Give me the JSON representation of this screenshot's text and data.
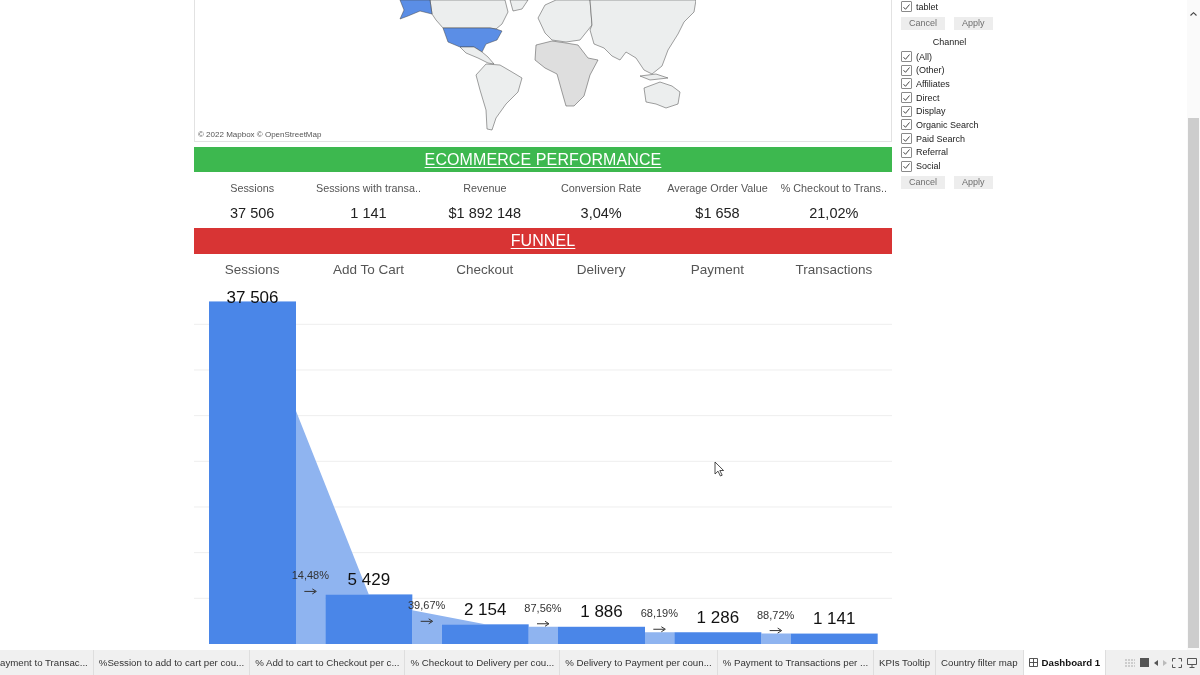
{
  "map": {
    "attribution": "© 2022 Mapbox © OpenStreetMap"
  },
  "ecommerce_performance": {
    "title": "ECOMMERCE PERFORMANCE",
    "kpis": [
      {
        "label": "Sessions",
        "value": "37 506"
      },
      {
        "label": "Sessions with transa..",
        "value": "1 141"
      },
      {
        "label": "Revenue",
        "value": "$1 892 148"
      },
      {
        "label": "Conversion Rate",
        "value": "3,04%"
      },
      {
        "label": "Average Order Value",
        "value": "$1 658"
      },
      {
        "label": "% Checkout to Trans..",
        "value": "21,02%"
      }
    ]
  },
  "funnel": {
    "title": "FUNNEL",
    "chart_data": [
      {
        "type": "bar",
        "categories": [
          "Sessions",
          "Add To Cart",
          "Checkout",
          "Delivery",
          "Payment",
          "Transactions"
        ],
        "values": [
          37506,
          5429,
          2154,
          1886,
          1286,
          1141
        ],
        "value_labels": [
          "37 506",
          "5 429",
          "2 154",
          "1 886",
          "1 286",
          "1 141"
        ],
        "data_labels": true,
        "color": "#4a86e8",
        "grid": true,
        "annotations": [
          "14,48%",
          "39,67%",
          "87,56%",
          "68,19%",
          "88,72%"
        ]
      }
    ]
  },
  "filters": [
    {
      "items": [
        {
          "label": "tablet",
          "checked": true
        }
      ],
      "buttons": [
        {
          "label": "Cancel",
          "disabled": true
        },
        {
          "label": "Apply",
          "disabled": true
        }
      ]
    },
    {
      "title": "Channel",
      "items": [
        {
          "label": "(All)",
          "checked": true
        },
        {
          "label": "(Other)",
          "checked": true
        },
        {
          "label": "Affiliates",
          "checked": true
        },
        {
          "label": "Direct",
          "checked": true
        },
        {
          "label": "Display",
          "checked": true
        },
        {
          "label": "Organic Search",
          "checked": true
        },
        {
          "label": "Paid Search",
          "checked": true
        },
        {
          "label": "Referral",
          "checked": true
        },
        {
          "label": "Social",
          "checked": true
        }
      ],
      "buttons": [
        {
          "label": "Cancel",
          "disabled": true
        },
        {
          "label": "Apply",
          "disabled": true
        }
      ]
    }
  ],
  "sheet_tabs": [
    {
      "label": "ayment to Transac...",
      "kind": "sheet",
      "selected": false
    },
    {
      "label": "%Session to add to cart per cou...",
      "kind": "sheet",
      "selected": false
    },
    {
      "label": "% Add to cart to Checkout per c...",
      "kind": "sheet",
      "selected": false
    },
    {
      "label": "% Checkout to Delivery per cou...",
      "kind": "sheet",
      "selected": false
    },
    {
      "label": "% Delivery to Payment per coun...",
      "kind": "sheet",
      "selected": false
    },
    {
      "label": "% Payment to Transactions per ...",
      "kind": "sheet",
      "selected": false
    },
    {
      "label": "KPIs Tooltip",
      "kind": "sheet",
      "selected": false
    },
    {
      "label": "Country filter map",
      "kind": "sheet",
      "selected": false
    },
    {
      "label": "Dashboard 1",
      "kind": "dashboard",
      "selected": true
    }
  ]
}
